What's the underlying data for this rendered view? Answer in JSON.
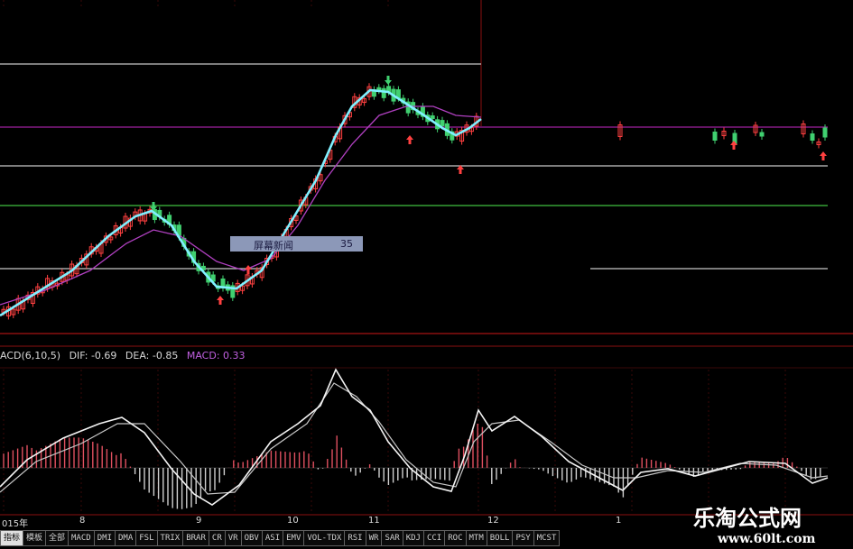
{
  "macd_legend": {
    "name": "ACD(6,10,5)",
    "dif": "DIF: -0.69",
    "dea": "DEA: -0.85",
    "macd": "MACD: 0.33"
  },
  "tooltip": {
    "label": "屏幕新闻",
    "value": "35"
  },
  "date_axis": [
    "015年",
    "8",
    "9",
    "10",
    "11",
    "12",
    "1"
  ],
  "tabs": [
    "指标",
    "模板",
    "全部",
    "MACD",
    "DMI",
    "DMA",
    "FSL",
    "TRIX",
    "BRAR",
    "CR",
    "VR",
    "OBV",
    "ASI",
    "EMV",
    "VOL-TDX",
    "RSI",
    "WR",
    "SAR",
    "KDJ",
    "CCI",
    "ROC",
    "MTM",
    "BOLL",
    "PSY",
    "MCST"
  ],
  "watermark": {
    "title": "乐淘公式网",
    "url": "www.60lt.com"
  },
  "colors": {
    "up_candle": "#ff4040",
    "down_candle": "#40d070",
    "ma_fast": "#80f0ff",
    "ma_slow": "#b040c0",
    "level_line_white": "#c8c8c8",
    "level_line_green": "#40c040",
    "level_line_purple": "#a020a0",
    "frame_red": "#8a1010",
    "macd_bar_pos": "#e05060",
    "macd_bar_neg": "#d0d0d0",
    "dif_line": "#f0f0f0"
  },
  "signals": {
    "buy": "red up arrow",
    "sell": "green down arrow"
  }
}
